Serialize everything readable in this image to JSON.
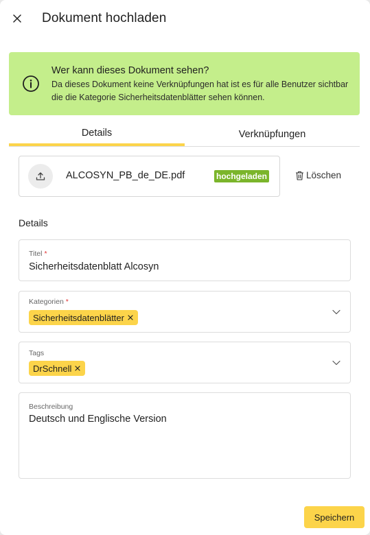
{
  "dialog": {
    "title": "Dokument hochladen"
  },
  "info_banner": {
    "heading": "Wer kann dieses Dokument sehen?",
    "text": "Da dieses Dokument keine Verknüpfungen hat ist es für alle Benutzer sichtbar die die Kategorie Sicherheitsdatenblätter sehen können.",
    "icon": "info-icon",
    "color": "#c4ee8b"
  },
  "tabs": [
    {
      "label": "Details",
      "active": true
    },
    {
      "label": "Verknüpfungen",
      "active": false
    }
  ],
  "file": {
    "name": "ALCOSYN_PB_de_DE.pdf",
    "status": "hochgeladen",
    "status_color": "#7bb52b",
    "delete_label": "Löschen"
  },
  "details": {
    "section_title": "Details",
    "title_field": {
      "label": "Titel",
      "required": "*",
      "value": "Sicherheitsdatenblatt Alcosyn"
    },
    "categories_field": {
      "label": "Kategorien",
      "required": "*",
      "chips": [
        "Sicherheitsdatenblätter"
      ]
    },
    "tags_field": {
      "label": "Tags",
      "chips": [
        "DrSchnell"
      ]
    },
    "description_field": {
      "label": "Beschreibung",
      "value": "Deutsch und Englische Version"
    }
  },
  "footer": {
    "save_label": "Speichern"
  },
  "colors": {
    "accent": "#fcd44a",
    "banner": "#c4ee8b",
    "required": "#e03131"
  }
}
